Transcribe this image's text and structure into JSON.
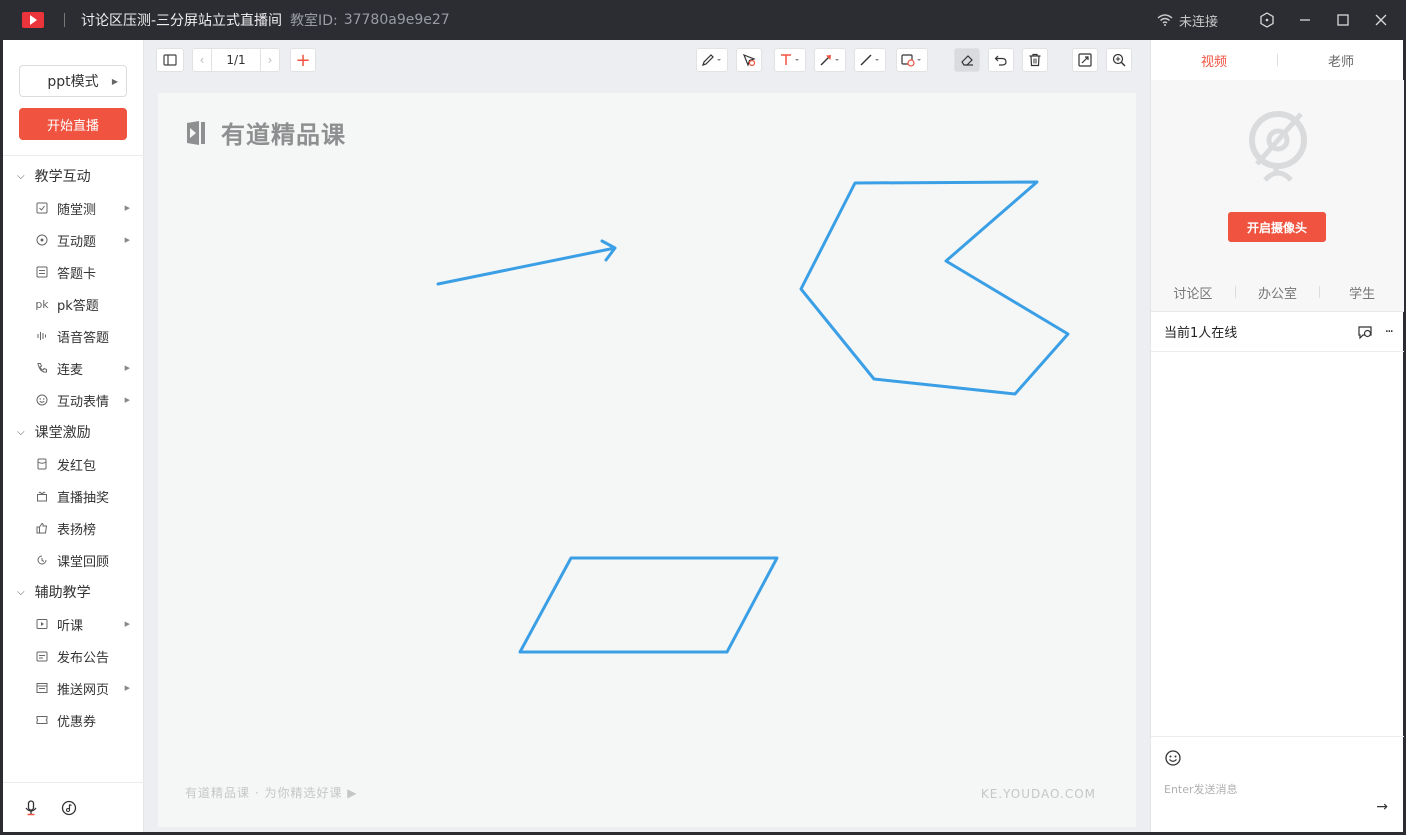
{
  "titlebar": {
    "title": "讨论区压测-三分屏站立式直播间",
    "room_label": "教室ID:",
    "room_id": "37780a9e9e27",
    "net_status": "未连接"
  },
  "sidebar": {
    "mode": "ppt模式",
    "start_button": "开始直播",
    "groups": [
      {
        "title": "教学互动",
        "items": [
          "随堂测",
          "互动题",
          "答题卡",
          "pk答题",
          "语音答题",
          "连麦",
          "互动表情"
        ]
      },
      {
        "title": "课堂激励",
        "items": [
          "发红包",
          "直播抽奖",
          "表扬榜",
          "课堂回顾"
        ]
      },
      {
        "title": "辅助教学",
        "items": [
          "听课",
          "发布公告",
          "推送网页",
          "优惠券"
        ]
      }
    ],
    "pk_prefix": "pk"
  },
  "toolbar": {
    "page": "1/1",
    "add": "+"
  },
  "canvas": {
    "logo_text": "有道精品课",
    "footer_left": "有道精品课 · 为你精选好课 ▶",
    "footer_right": "KE.YOUDAO.COM",
    "stroke_color": "#3b9fe6"
  },
  "right_panel": {
    "tabs": [
      "视频",
      "老师"
    ],
    "camera_button": "开启摄像头",
    "discussion_tabs": [
      "讨论区",
      "办公室",
      "学生"
    ],
    "online_text": "当前1人在线",
    "more": "···",
    "chat_placeholder": "Enter发送消息",
    "send": "→"
  },
  "colors": {
    "accent": "#f0533f",
    "titlebar": "#2b2d33"
  }
}
